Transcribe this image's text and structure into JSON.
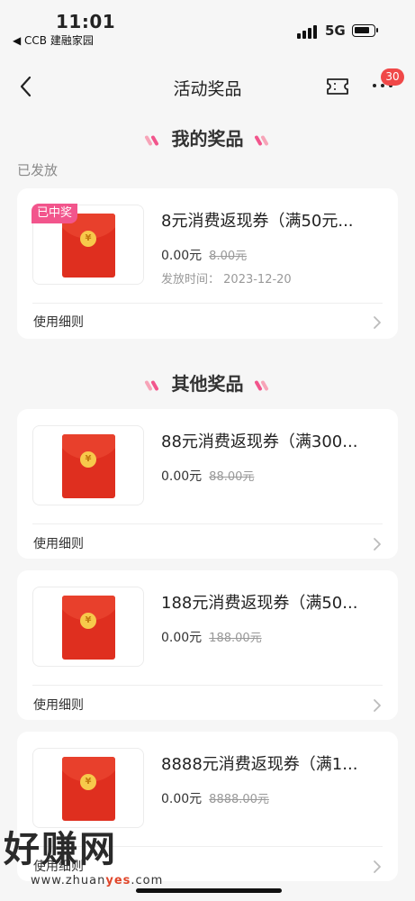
{
  "status": {
    "time": "11:01",
    "back_app": "◀ CCB 建融家园",
    "network": "5G"
  },
  "nav": {
    "title": "活动奖品",
    "badge": "30",
    "back_icon": "chevron-left-icon",
    "ticket_icon": "ticket-icon",
    "more_icon": "more-icon"
  },
  "my_prizes": {
    "heading": "我的奖品",
    "subheading": "已发放",
    "items": [
      {
        "tag": "已中奖",
        "title": "8元消费返现券（满50元...",
        "price": "0.00元",
        "original": "8.00元",
        "issue_label": "发放时间：",
        "issue_date": "2023-12-20",
        "rules": "使用细则"
      }
    ]
  },
  "other_prizes": {
    "heading": "其他奖品",
    "items": [
      {
        "title": "88元消费返现券（满300...",
        "price": "0.00元",
        "original": "88.00元",
        "rules": "使用细则"
      },
      {
        "title": "188元消费返现券（满50...",
        "price": "0.00元",
        "original": "188.00元",
        "rules": "使用细则"
      },
      {
        "title": "8888元消费返现券（满1...",
        "price": "0.00元",
        "original": "8888.00元",
        "rules": "使用细则"
      }
    ]
  },
  "watermark": {
    "brand": "好赚网",
    "url_prefix": "www.zhuan",
    "url_accent": "yes",
    "url_suffix": ".com"
  },
  "colors": {
    "accent_pink": "#f2558c",
    "envelope_red": "#df2f1f",
    "badge_red": "#f04848"
  }
}
